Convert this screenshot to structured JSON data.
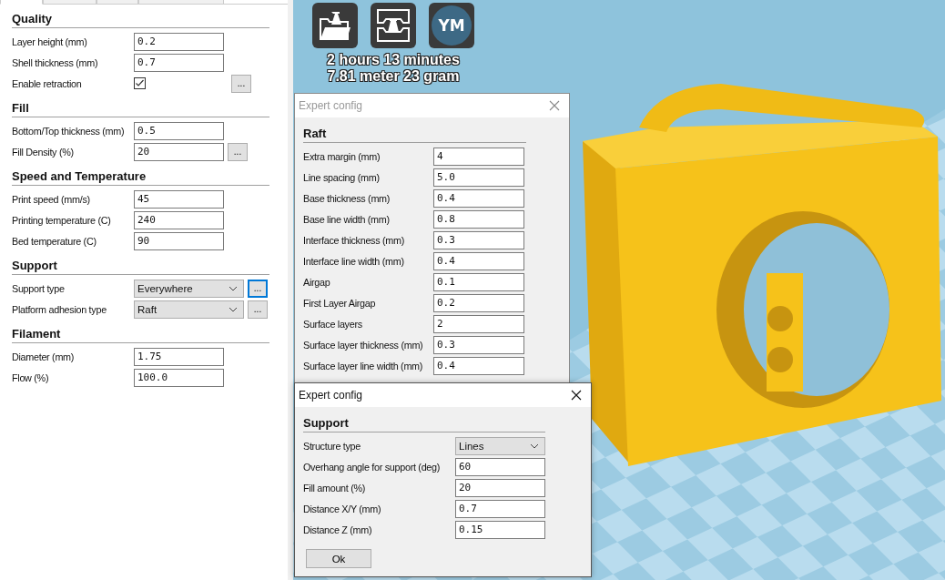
{
  "sidebar": {
    "tabs": [
      {
        "selected": true
      },
      {
        "selected": false
      },
      {
        "selected": false
      },
      {
        "selected": false
      }
    ],
    "sections": [
      {
        "title": "Quality",
        "rows": [
          {
            "kind": "text",
            "label": "Layer height (mm)",
            "value": "0.2"
          },
          {
            "kind": "text",
            "label": "Shell thickness (mm)",
            "value": "0.7"
          },
          {
            "kind": "checkbox",
            "label": "Enable retraction",
            "checked": true,
            "more": {
              "label": "...",
              "focused": false
            }
          }
        ]
      },
      {
        "title": "Fill",
        "rows": [
          {
            "kind": "text",
            "label": "Bottom/Top thickness (mm)",
            "value": "0.5"
          },
          {
            "kind": "text",
            "label": "Fill Density (%)",
            "value": "20",
            "more": {
              "label": "...",
              "focused": false
            }
          }
        ]
      },
      {
        "title": "Speed and Temperature",
        "rows": [
          {
            "kind": "text",
            "label": "Print speed (mm/s)",
            "value": "45"
          },
          {
            "kind": "text",
            "label": "Printing temperature (C)",
            "value": "240"
          },
          {
            "kind": "text",
            "label": "Bed temperature (C)",
            "value": "90"
          }
        ]
      },
      {
        "title": "Support",
        "rows": [
          {
            "kind": "select",
            "label": "Support type",
            "value": "Everywhere",
            "more": {
              "label": "...",
              "focused": true
            }
          },
          {
            "kind": "select",
            "label": "Platform adhesion type",
            "value": "Raft",
            "more": {
              "label": "...",
              "focused": false
            }
          }
        ]
      },
      {
        "title": "Filament",
        "rows": [
          {
            "kind": "text",
            "label": "Diameter (mm)",
            "value": "1.75"
          },
          {
            "kind": "text",
            "label": "Flow (%)",
            "value": "100.0"
          }
        ]
      }
    ]
  },
  "toolbar": [
    {
      "kind": "load"
    },
    {
      "kind": "print"
    },
    {
      "kind": "account",
      "label": "YM"
    }
  ],
  "print_estimate": [
    "2 hours 13 minutes",
    "7.81 meter 23 gram"
  ],
  "dialogs": [
    {
      "title": "Expert config",
      "active": false,
      "section": "Raft",
      "rows": [
        {
          "kind": "text",
          "label": "Extra margin (mm)",
          "value": "4"
        },
        {
          "kind": "text",
          "label": "Line spacing (mm)",
          "value": "5.0"
        },
        {
          "kind": "text",
          "label": "Base thickness (mm)",
          "value": "0.4"
        },
        {
          "kind": "text",
          "label": "Base line width (mm)",
          "value": "0.8"
        },
        {
          "kind": "text",
          "label": "Interface thickness (mm)",
          "value": "0.3"
        },
        {
          "kind": "text",
          "label": "Interface line width (mm)",
          "value": "0.4"
        },
        {
          "kind": "text",
          "label": "Airgap",
          "value": "0.1"
        },
        {
          "kind": "text",
          "label": "First Layer Airgap",
          "value": "0.2"
        },
        {
          "kind": "text",
          "label": "Surface layers",
          "value": "2"
        },
        {
          "kind": "text",
          "label": "Surface layer thickness (mm)",
          "value": "0.3"
        },
        {
          "kind": "text",
          "label": "Surface layer line width (mm)",
          "value": "0.4"
        }
      ]
    },
    {
      "title": "Expert config",
      "active": true,
      "section": "Support",
      "rows": [
        {
          "kind": "select",
          "label": "Structure type",
          "value": "Lines"
        },
        {
          "kind": "text",
          "label": "Overhang angle for support (deg)",
          "value": "60"
        },
        {
          "kind": "text",
          "label": "Fill amount (%)",
          "value": "20"
        },
        {
          "kind": "text",
          "label": "Distance X/Y (mm)",
          "value": "0.7"
        },
        {
          "kind": "text",
          "label": "Distance Z (mm)",
          "value": "0.15"
        }
      ],
      "buttons": [
        "Ok"
      ]
    }
  ]
}
